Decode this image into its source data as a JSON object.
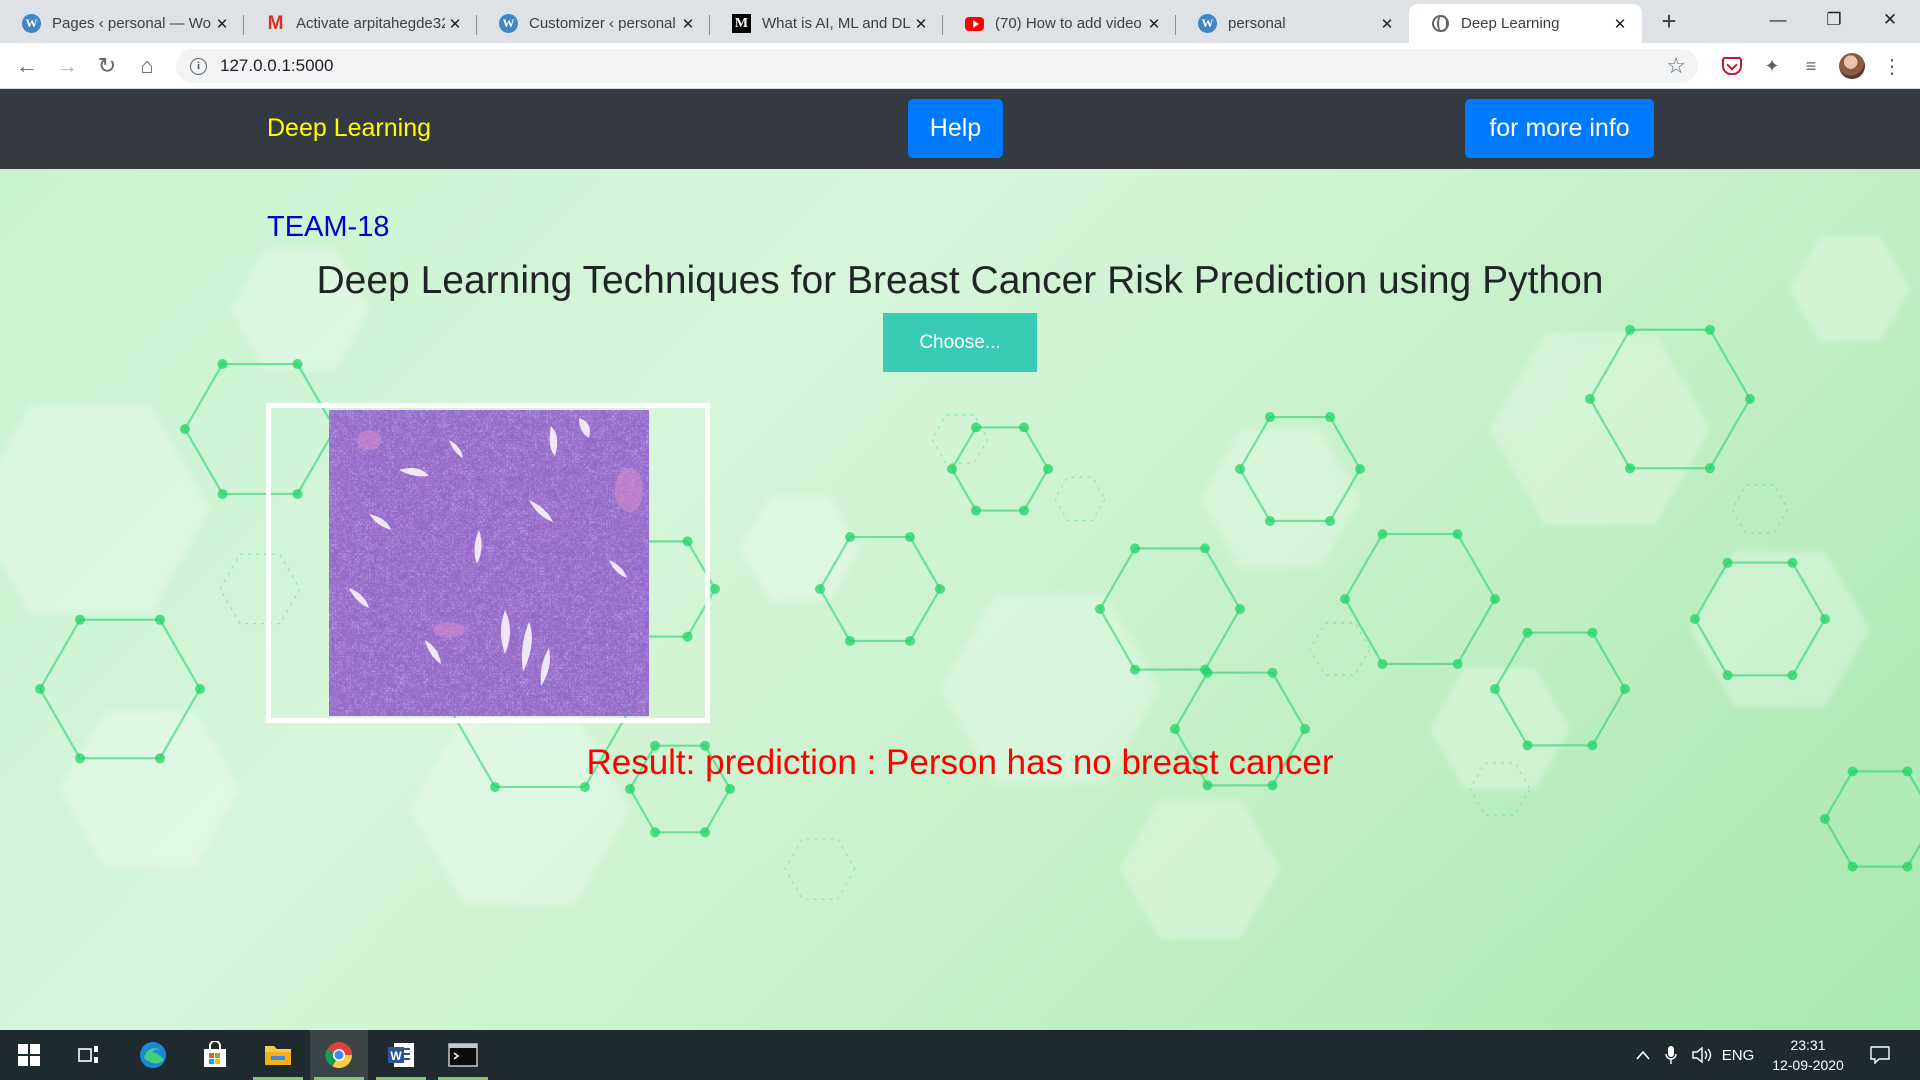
{
  "browser": {
    "tabs": [
      {
        "title": "Pages ‹ personal — Wo",
        "icon": "wordpress-icon"
      },
      {
        "title": "Activate arpitahegde32",
        "icon": "gmail-icon"
      },
      {
        "title": "Customizer ‹ personal –",
        "icon": "wordpress-icon"
      },
      {
        "title": "What is AI, ML and DL?",
        "icon": "medium-icon"
      },
      {
        "title": "(70) How to add video",
        "icon": "youtube-icon"
      },
      {
        "title": "personal",
        "icon": "wordpress-icon"
      },
      {
        "title": "Deep Learning",
        "icon": "globe-icon",
        "active": true
      }
    ],
    "url": "127.0.0.1:5000"
  },
  "site": {
    "brand": "Deep Learning",
    "help_label": "Help",
    "more_info_label": "for more info",
    "team": "TEAM-18",
    "heading": "Deep Learning Techniques for Breast Cancer Risk Prediction using Python",
    "choose_label": "Choose...",
    "result": "Result: prediction : Person has no breast cancer",
    "colors": {
      "navbar": "#343a40",
      "brand": "#ffff00",
      "button": "#007bff",
      "team": "#0000cd",
      "choose": "#39ccb4",
      "result": "#ff0000"
    }
  },
  "taskbar": {
    "apps": [
      "start-icon",
      "task-view-icon",
      "edge-icon",
      "store-icon",
      "file-explorer-icon",
      "chrome-icon",
      "word-icon",
      "terminal-icon"
    ],
    "language": "ENG",
    "time": "23:31",
    "date": "12-09-2020"
  }
}
